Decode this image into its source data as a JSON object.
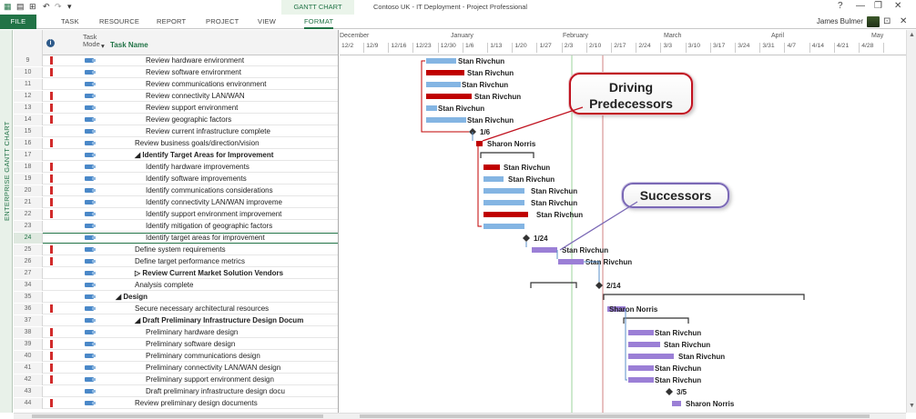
{
  "titlebar": {
    "contextual_tab": "GANTT CHART TOOLS",
    "window_title": "Contoso UK - IT Deployment - Project Professional",
    "help": "?",
    "minimize": "—",
    "restore": "❐",
    "close": "✕"
  },
  "ribbon": {
    "tabs": [
      "FILE",
      "TASK",
      "RESOURCE",
      "REPORT",
      "PROJECT",
      "VIEW",
      "FORMAT"
    ],
    "user_name": "James Bulmer"
  },
  "side_label": "ENTERPRISE GANTT CHART",
  "table": {
    "col_mode": "Task\nMode",
    "col_name": "Task Name",
    "rows": [
      {
        "id": "9",
        "ind": true,
        "name": "Review hardware environment",
        "level": 3,
        "bold": false
      },
      {
        "id": "10",
        "ind": true,
        "name": "Review software environment",
        "level": 3,
        "bold": false
      },
      {
        "id": "11",
        "ind": false,
        "name": "Review communications environment",
        "level": 3,
        "bold": false
      },
      {
        "id": "12",
        "ind": true,
        "name": "Review connectivity LAN/WAN",
        "level": 3,
        "bold": false
      },
      {
        "id": "13",
        "ind": true,
        "name": "Review support environment",
        "level": 3,
        "bold": false
      },
      {
        "id": "14",
        "ind": true,
        "name": "Review geographic factors",
        "level": 3,
        "bold": false
      },
      {
        "id": "15",
        "ind": false,
        "name": "Review current infrastructure complete",
        "level": 3,
        "bold": false
      },
      {
        "id": "16",
        "ind": true,
        "name": "Review business goals/direction/vision",
        "level": 2,
        "bold": false
      },
      {
        "id": "17",
        "ind": false,
        "name": "◢ Identify Target Areas for Improvement",
        "level": 2,
        "bold": true
      },
      {
        "id": "18",
        "ind": true,
        "name": "Identify hardware improvements",
        "level": 3,
        "bold": false
      },
      {
        "id": "19",
        "ind": true,
        "name": "Identify software improvements",
        "level": 3,
        "bold": false
      },
      {
        "id": "20",
        "ind": true,
        "name": "Identify communications considerations",
        "level": 3,
        "bold": false
      },
      {
        "id": "21",
        "ind": true,
        "name": "Identify connectivity LAN/WAN improveme",
        "level": 3,
        "bold": false
      },
      {
        "id": "22",
        "ind": true,
        "name": "Identify support environment improvement",
        "level": 3,
        "bold": false
      },
      {
        "id": "23",
        "ind": false,
        "name": "Identify mitigation of geographic factors",
        "level": 3,
        "bold": false
      },
      {
        "id": "24",
        "ind": false,
        "name": "Identify target areas for improvement",
        "level": 3,
        "bold": false,
        "selected": true
      },
      {
        "id": "25",
        "ind": true,
        "name": "Define system requirements",
        "level": 2,
        "bold": false
      },
      {
        "id": "26",
        "ind": true,
        "name": "Define target performance metrics",
        "level": 2,
        "bold": false
      },
      {
        "id": "27",
        "ind": false,
        "name": "▷ Review Current Market Solution Vendors",
        "level": 2,
        "bold": true
      },
      {
        "id": "34",
        "ind": false,
        "name": "Analysis complete",
        "level": 2,
        "bold": false
      },
      {
        "id": "35",
        "ind": false,
        "name": "◢ Design",
        "level": 1,
        "bold": true
      },
      {
        "id": "36",
        "ind": true,
        "name": "Secure necessary architectural resources",
        "level": 2,
        "bold": false
      },
      {
        "id": "37",
        "ind": false,
        "name": "◢ Draft Preliminary Infrastructure Design Docum",
        "level": 2,
        "bold": true
      },
      {
        "id": "38",
        "ind": true,
        "name": "Preliminary hardware design",
        "level": 3,
        "bold": false
      },
      {
        "id": "39",
        "ind": true,
        "name": "Preliminary software design",
        "level": 3,
        "bold": false
      },
      {
        "id": "40",
        "ind": true,
        "name": "Preliminary communications design",
        "level": 3,
        "bold": false
      },
      {
        "id": "41",
        "ind": true,
        "name": "Preliminary connectivity LAN/WAN design",
        "level": 3,
        "bold": false
      },
      {
        "id": "42",
        "ind": true,
        "name": "Preliminary support environment design",
        "level": 3,
        "bold": false
      },
      {
        "id": "43",
        "ind": false,
        "name": "Draft preliminary infrastructure design docu",
        "level": 3,
        "bold": false
      },
      {
        "id": "44",
        "ind": true,
        "name": "Review preliminary design documents",
        "level": 2,
        "bold": false
      }
    ]
  },
  "gantt": {
    "months": [
      "December",
      "January",
      "February",
      "March",
      "April",
      "May"
    ],
    "dates": [
      "12/2",
      "12/9",
      "12/16",
      "12/23",
      "12/30",
      "1/6",
      "1/13",
      "1/20",
      "1/27",
      "2/3",
      "2/10",
      "2/17",
      "2/24",
      "3/3",
      "3/10",
      "3/17",
      "3/24",
      "3/31",
      "4/7",
      "4/14",
      "4/21",
      "4/28"
    ],
    "labels": {
      "stan": "Stan Rivchun",
      "sharon": "Sharon Norris",
      "m1": "1/6",
      "m2": "1/24",
      "m3": "2/14",
      "m4": "3/5"
    },
    "colors": {
      "critical": "#c00000",
      "normal": "#84b5e3",
      "successor": "#9b7fd6",
      "driving_border": "#c0121f",
      "successor_border": "#7a68b5"
    }
  },
  "callouts": {
    "driving": "Driving\nPredecessors",
    "successors": "Successors"
  }
}
